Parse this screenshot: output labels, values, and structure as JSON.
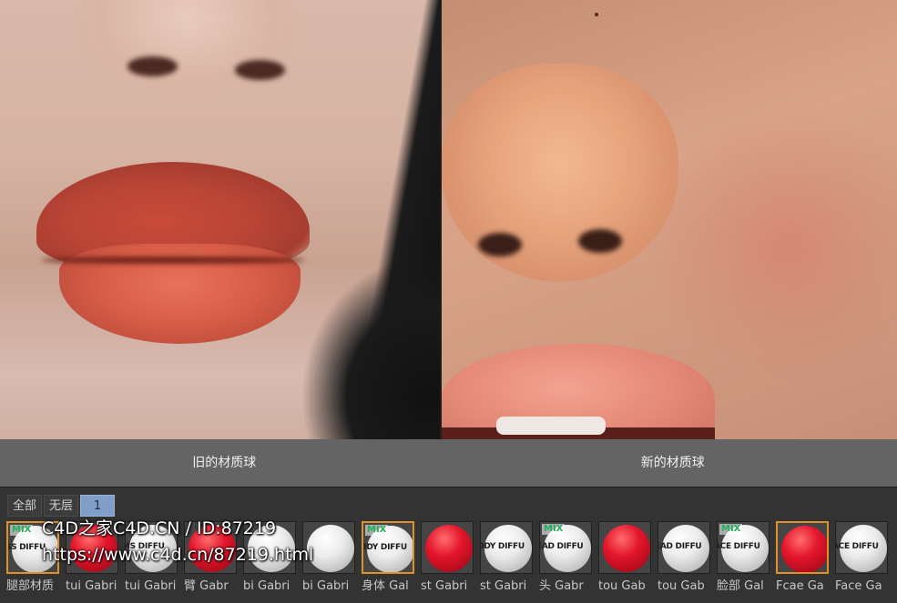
{
  "captions": {
    "left": "旧的材质球",
    "right": "新的材质球"
  },
  "layer_tabs": [
    {
      "label": "全部",
      "active": false
    },
    {
      "label": "无层",
      "active": false
    },
    {
      "label": "1",
      "active": true
    }
  ],
  "materials": [
    {
      "label": "腿部材质",
      "sphere": "white",
      "mix": true,
      "texture_text": "GS DIFFU",
      "selected": true
    },
    {
      "label": "tui Gabri",
      "sphere": "red",
      "mix": false,
      "texture_text": "",
      "selected": false
    },
    {
      "label": "tui Gabri",
      "sphere": "white",
      "mix": false,
      "texture_text": "MS DIFFU",
      "selected": false
    },
    {
      "label": "臂 Gabr",
      "sphere": "red",
      "mix": false,
      "texture_text": "",
      "selected": false
    },
    {
      "label": "bi Gabri",
      "sphere": "white",
      "mix": false,
      "texture_text": "",
      "selected": false
    },
    {
      "label": "bi Gabri",
      "sphere": "white",
      "mix": false,
      "texture_text": "",
      "selected": false
    },
    {
      "label": "身体 Gal",
      "sphere": "white",
      "mix": true,
      "texture_text": "ODY DIFFU",
      "selected": true
    },
    {
      "label": "st Gabri",
      "sphere": "red",
      "mix": false,
      "texture_text": "",
      "selected": false
    },
    {
      "label": "st Gabri",
      "sphere": "white",
      "mix": false,
      "texture_text": "ODY DIFFU",
      "selected": false
    },
    {
      "label": "头 Gabr",
      "sphere": "white",
      "mix": true,
      "texture_text": "EAD DIFFU",
      "selected": false
    },
    {
      "label": "tou Gab",
      "sphere": "red",
      "mix": false,
      "texture_text": "",
      "selected": false
    },
    {
      "label": "tou Gab",
      "sphere": "white",
      "mix": false,
      "texture_text": "EAD DIFFU",
      "selected": false
    },
    {
      "label": "脸部 Gal",
      "sphere": "white",
      "mix": true,
      "texture_text": "ACE DIFFU",
      "selected": false
    },
    {
      "label": "Fcae Ga",
      "sphere": "red",
      "mix": false,
      "texture_text": "",
      "selected": true
    },
    {
      "label": "Face Ga",
      "sphere": "white",
      "mix": false,
      "texture_text": "ACE DIFFU",
      "selected": false
    }
  ],
  "mix_badge": "MIX",
  "watermark": {
    "line1": "C4D之家C4D.CN / ID:87219",
    "line2": "https://www.c4d.cn/87219.html"
  }
}
